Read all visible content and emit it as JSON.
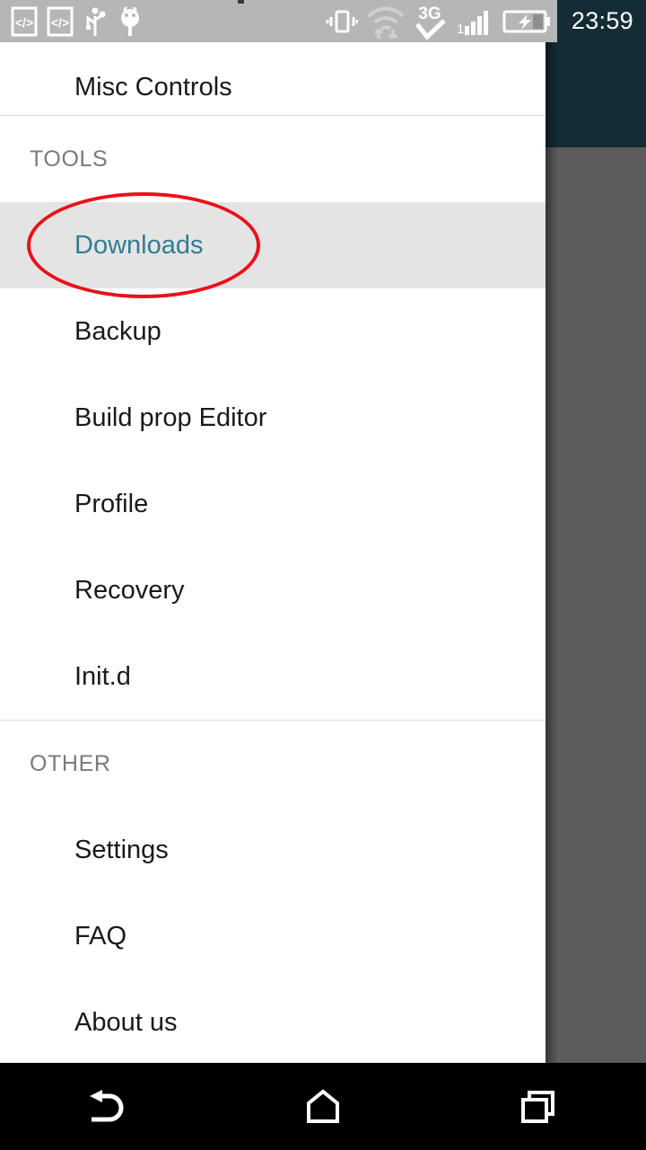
{
  "status_bar": {
    "time": "23:59",
    "background_color": "#b6b6b6",
    "clock_background_color": "#132c36",
    "left_icons": [
      {
        "name": "developer-code-icon-1",
        "glyph": "</>"
      },
      {
        "name": "developer-code-icon-2",
        "glyph": "</>"
      },
      {
        "name": "usb-debugging-icon",
        "glyph": "usb"
      },
      {
        "name": "android-debug-bridge-icon",
        "glyph": "android"
      }
    ],
    "right_icons": [
      {
        "name": "vibrate-mode-icon",
        "glyph": "vibrate"
      },
      {
        "name": "wifi-signal-icon",
        "glyph": "wifi"
      },
      {
        "name": "mobile-data-3g-icon",
        "glyph": "3G"
      },
      {
        "name": "cellular-signal-icon",
        "glyph": "signal"
      },
      {
        "name": "battery-charging-icon",
        "glyph": "battery"
      }
    ]
  },
  "drawer": {
    "background_color": "#ffffff",
    "selected_item_background": "#e4e4e4",
    "selected_item_text_color": "#337c94",
    "top_partial_item": {
      "label": "Misc Controls"
    },
    "sections": [
      {
        "header": "TOOLS",
        "items": [
          {
            "label": "Downloads",
            "selected": true
          },
          {
            "label": "Backup",
            "selected": false
          },
          {
            "label": "Build prop Editor",
            "selected": false
          },
          {
            "label": "Profile",
            "selected": false
          },
          {
            "label": "Recovery",
            "selected": false
          },
          {
            "label": "Init.d",
            "selected": false
          }
        ]
      },
      {
        "header": "OTHER",
        "items": [
          {
            "label": "Settings",
            "selected": false
          },
          {
            "label": "FAQ",
            "selected": false
          },
          {
            "label": "About us",
            "selected": false
          }
        ]
      }
    ]
  },
  "annotation": {
    "shape": "ellipse",
    "color": "#e8121a",
    "target_label": "Downloads"
  },
  "background_app": {
    "app_bar_color": "#132c36",
    "scrim_color": "#5c5c5c"
  },
  "navigation_bar": {
    "background_color": "#000000",
    "buttons": [
      {
        "name": "back-button",
        "icon": "back-arrow-icon"
      },
      {
        "name": "home-button",
        "icon": "home-icon"
      },
      {
        "name": "recents-button",
        "icon": "recents-squares-icon"
      }
    ]
  }
}
